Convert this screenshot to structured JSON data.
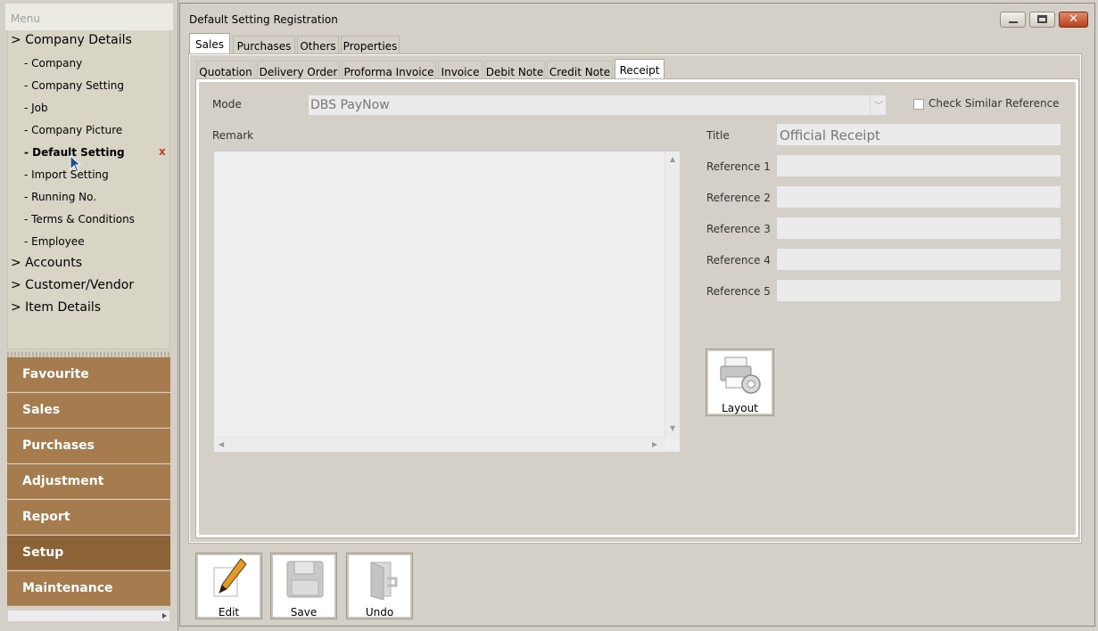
{
  "menu": {
    "header": "Menu",
    "groups": {
      "company_details": "> Company Details",
      "accounts": "> Accounts",
      "customer_vendor": "> Customer/Vendor",
      "item_details": "> Item Details"
    },
    "company_items": [
      "- Company",
      "- Company Setting",
      "- Job",
      "- Company Picture",
      "- Default Setting",
      "- Import Setting",
      "- Running No.",
      "- Terms & Conditions",
      "- Employee"
    ],
    "close_mark": "x",
    "nav": [
      "Favourite",
      "Sales",
      "Purchases",
      "Adjustment",
      "Report",
      "Setup",
      "Maintenance"
    ],
    "nav_selected": "Setup"
  },
  "window": {
    "title": "Default Setting Registration",
    "tabs": [
      "Sales",
      "Purchases",
      "Others",
      "Properties"
    ],
    "active_tab": "Sales",
    "subtabs": [
      "Quotation",
      "Delivery Order",
      "Proforma Invoice",
      "Invoice",
      "Debit Note",
      "Credit Note",
      "Receipt"
    ],
    "active_subtab": "Receipt"
  },
  "form": {
    "mode_label": "Mode",
    "mode_value": "DBS PayNow",
    "check_similar_label": "Check Similar Reference",
    "check_similar_checked": false,
    "remark_label": "Remark",
    "remark_value": "",
    "title_label": "Title",
    "title_value": "Official Receipt",
    "references": [
      {
        "label": "Reference 1",
        "value": ""
      },
      {
        "label": "Reference 2",
        "value": ""
      },
      {
        "label": "Reference 3",
        "value": ""
      },
      {
        "label": "Reference 4",
        "value": ""
      },
      {
        "label": "Reference 5",
        "value": ""
      }
    ],
    "layout_button": "Layout"
  },
  "toolbar": {
    "edit": "Edit",
    "save": "Save",
    "undo": "Undo"
  },
  "colors": {
    "background": "#d4d0c8",
    "nav": "#a67b4d",
    "nav_selected": "#8c6237",
    "close_mark": "#b4461e"
  }
}
